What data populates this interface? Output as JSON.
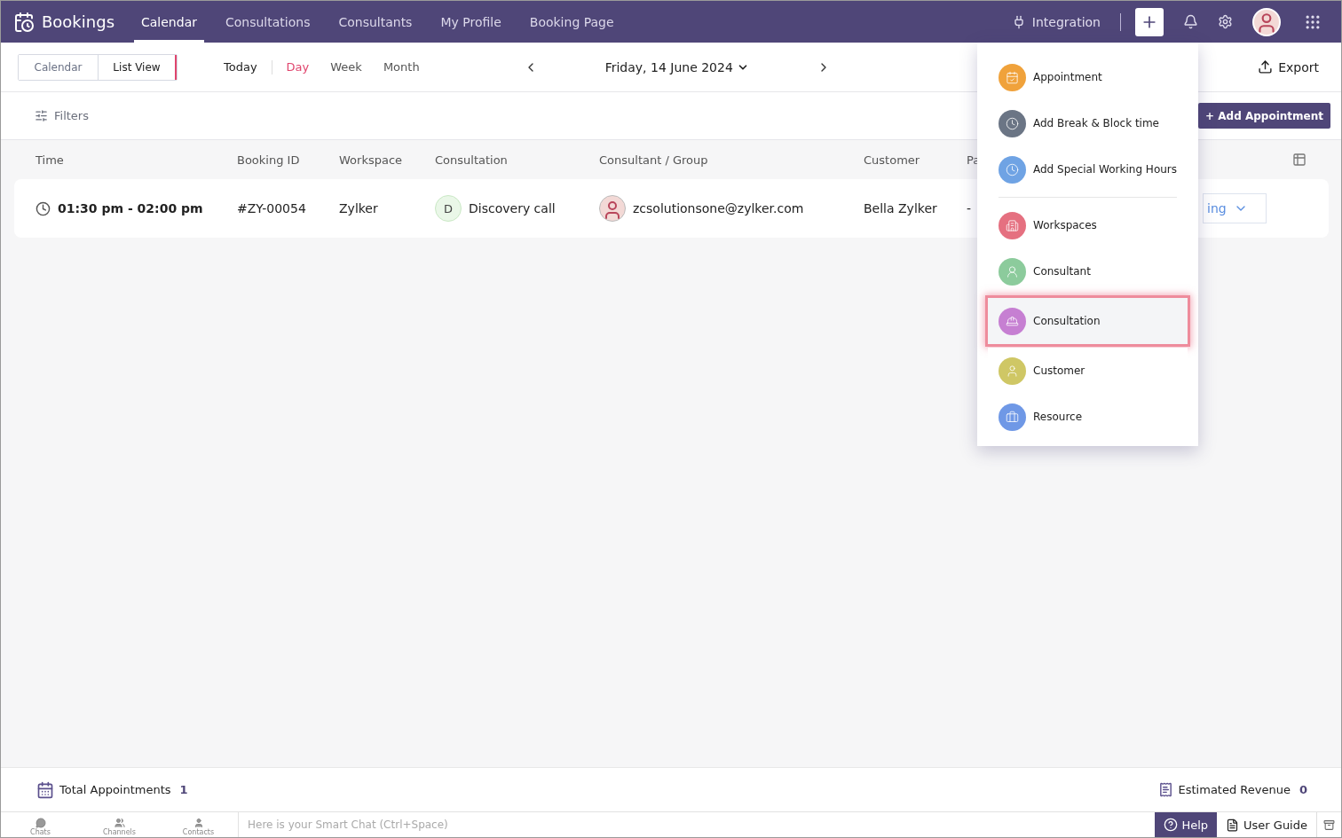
{
  "app": {
    "name": "Bookings"
  },
  "nav": [
    {
      "label": "Calendar",
      "selected": true
    },
    {
      "label": "Consultations",
      "selected": false
    },
    {
      "label": "Consultants",
      "selected": false
    },
    {
      "label": "My Profile",
      "selected": false
    },
    {
      "label": "Booking Page",
      "selected": false
    }
  ],
  "integration": "Integration",
  "view_toggle": [
    {
      "label": "Calendar",
      "selected": false
    },
    {
      "label": "List View",
      "selected": true
    }
  ],
  "today": "Today",
  "ranges": [
    {
      "label": "Day",
      "selected": true
    },
    {
      "label": "Week",
      "selected": false
    },
    {
      "label": "Month",
      "selected": false
    }
  ],
  "date": "Friday, 14 June 2024",
  "export": "Export",
  "filters": "Filters",
  "add_appointment": "+ Add Appointment",
  "table": {
    "columns": [
      "Time",
      "Booking ID",
      "Workspace",
      "Consultation",
      "Consultant / Group",
      "Customer",
      "Pa"
    ],
    "rows": [
      {
        "time": "01:30 pm - 02:00 pm",
        "booking_id": "#ZY-00054",
        "workspace": "Zylker",
        "consultation_initial": "D",
        "consultation": "Discovery call",
        "consultant": "zcsolutionsone@zylker.com",
        "customer": "Bella Zylker",
        "column_7": "-",
        "status": "ing"
      }
    ]
  },
  "create_menu": {
    "items": [
      {
        "label": "Appointment",
        "color": "#f0a23b",
        "selected": false
      },
      {
        "label": "Add Break & Block time",
        "color": "#6b7585",
        "selected": false
      },
      {
        "label": "Add Special Working Hours",
        "color": "#6fa3e4",
        "selected": false
      },
      {
        "label": "Workspaces",
        "color": "#e57080",
        "selected": false
      },
      {
        "label": "Consultant",
        "color": "#8ccb9c",
        "selected": false
      },
      {
        "label": "Consultation",
        "color": "#c67fd2",
        "selected": true
      },
      {
        "label": "Customer",
        "color": "#cfc765",
        "selected": false
      },
      {
        "label": "Resource",
        "color": "#6f98e6",
        "selected": false
      }
    ]
  },
  "summary": {
    "total_label": "Total Appointments",
    "total": "1",
    "revenue_label": "Estimated Revenue",
    "revenue": "0"
  },
  "chat_bar": {
    "tabs": [
      "Chats",
      "Channels",
      "Contacts"
    ],
    "placeholder": "Here is your Smart Chat (Ctrl+Space)",
    "help": "Help",
    "guide": "User Guide"
  }
}
